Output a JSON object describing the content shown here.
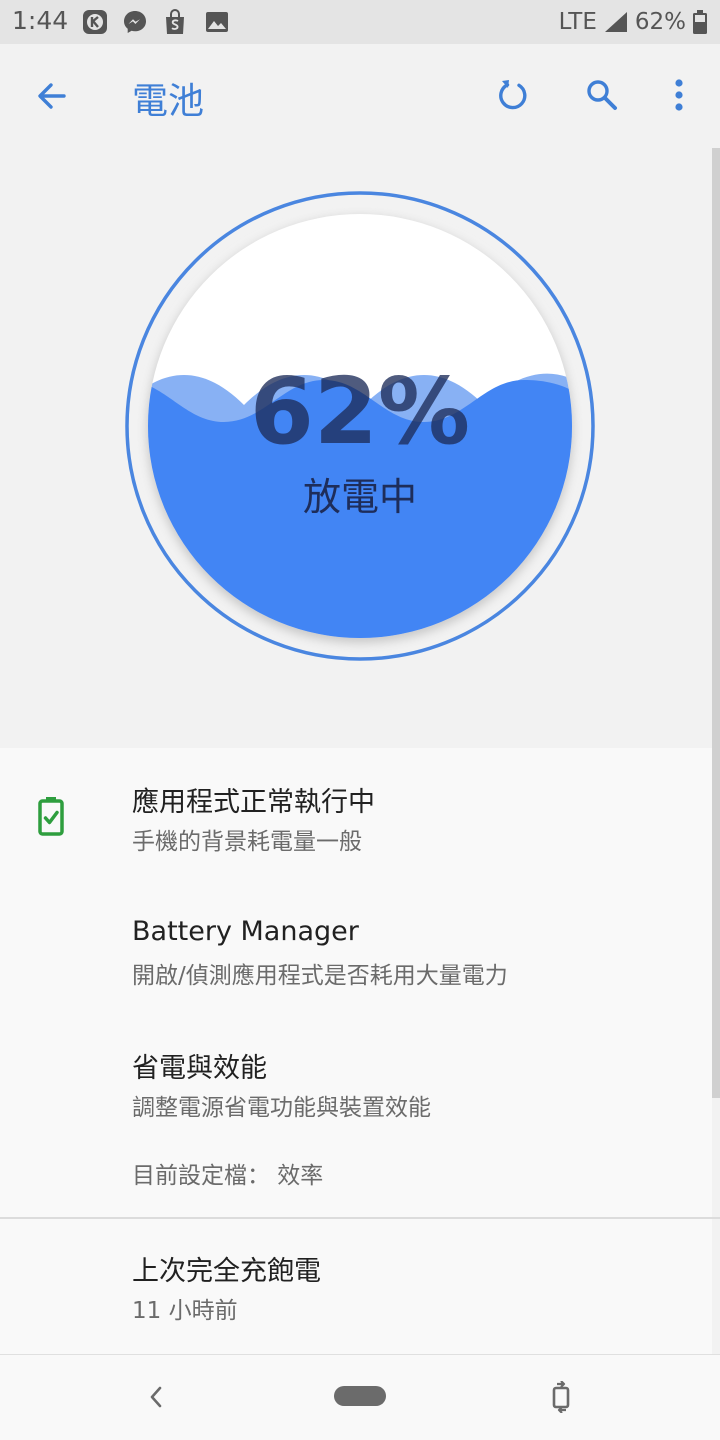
{
  "status_bar": {
    "time": "1:44",
    "network": "LTE",
    "battery": "62%",
    "notification_icons": [
      "k-app-icon",
      "messenger-icon",
      "shopping-bag-icon",
      "image-icon"
    ]
  },
  "app_bar": {
    "title": "電池",
    "back_icon": "arrow-back-icon",
    "refresh_icon": "refresh-icon",
    "search_icon": "search-icon",
    "more_icon": "more-vert-icon"
  },
  "gauge": {
    "percent_text": "62%",
    "level": 0.62,
    "status": "放電中",
    "fill_color": "#4285f4",
    "ring_color": "#4a86e0"
  },
  "list": {
    "apps_status": {
      "title": "應用程式正常執行中",
      "subtitle": "手機的背景耗電量一般",
      "icon": "battery-check-icon",
      "icon_color": "#2e9e3e"
    },
    "battery_manager": {
      "title": "Battery Manager",
      "subtitle": "開啟/偵測應用程式是否耗用大量電力"
    },
    "power_saving": {
      "title": "省電與效能",
      "subtitle": "調整電源省電功能與裝置效能",
      "profile": "目前設定檔： 效率"
    },
    "last_full_charge": {
      "title": "上次完全充飽電",
      "subtitle": "11 小時前"
    }
  },
  "nav_bar": {
    "back": "nav-back-icon",
    "home": "home-pill",
    "rotate": "rotate-icon"
  }
}
